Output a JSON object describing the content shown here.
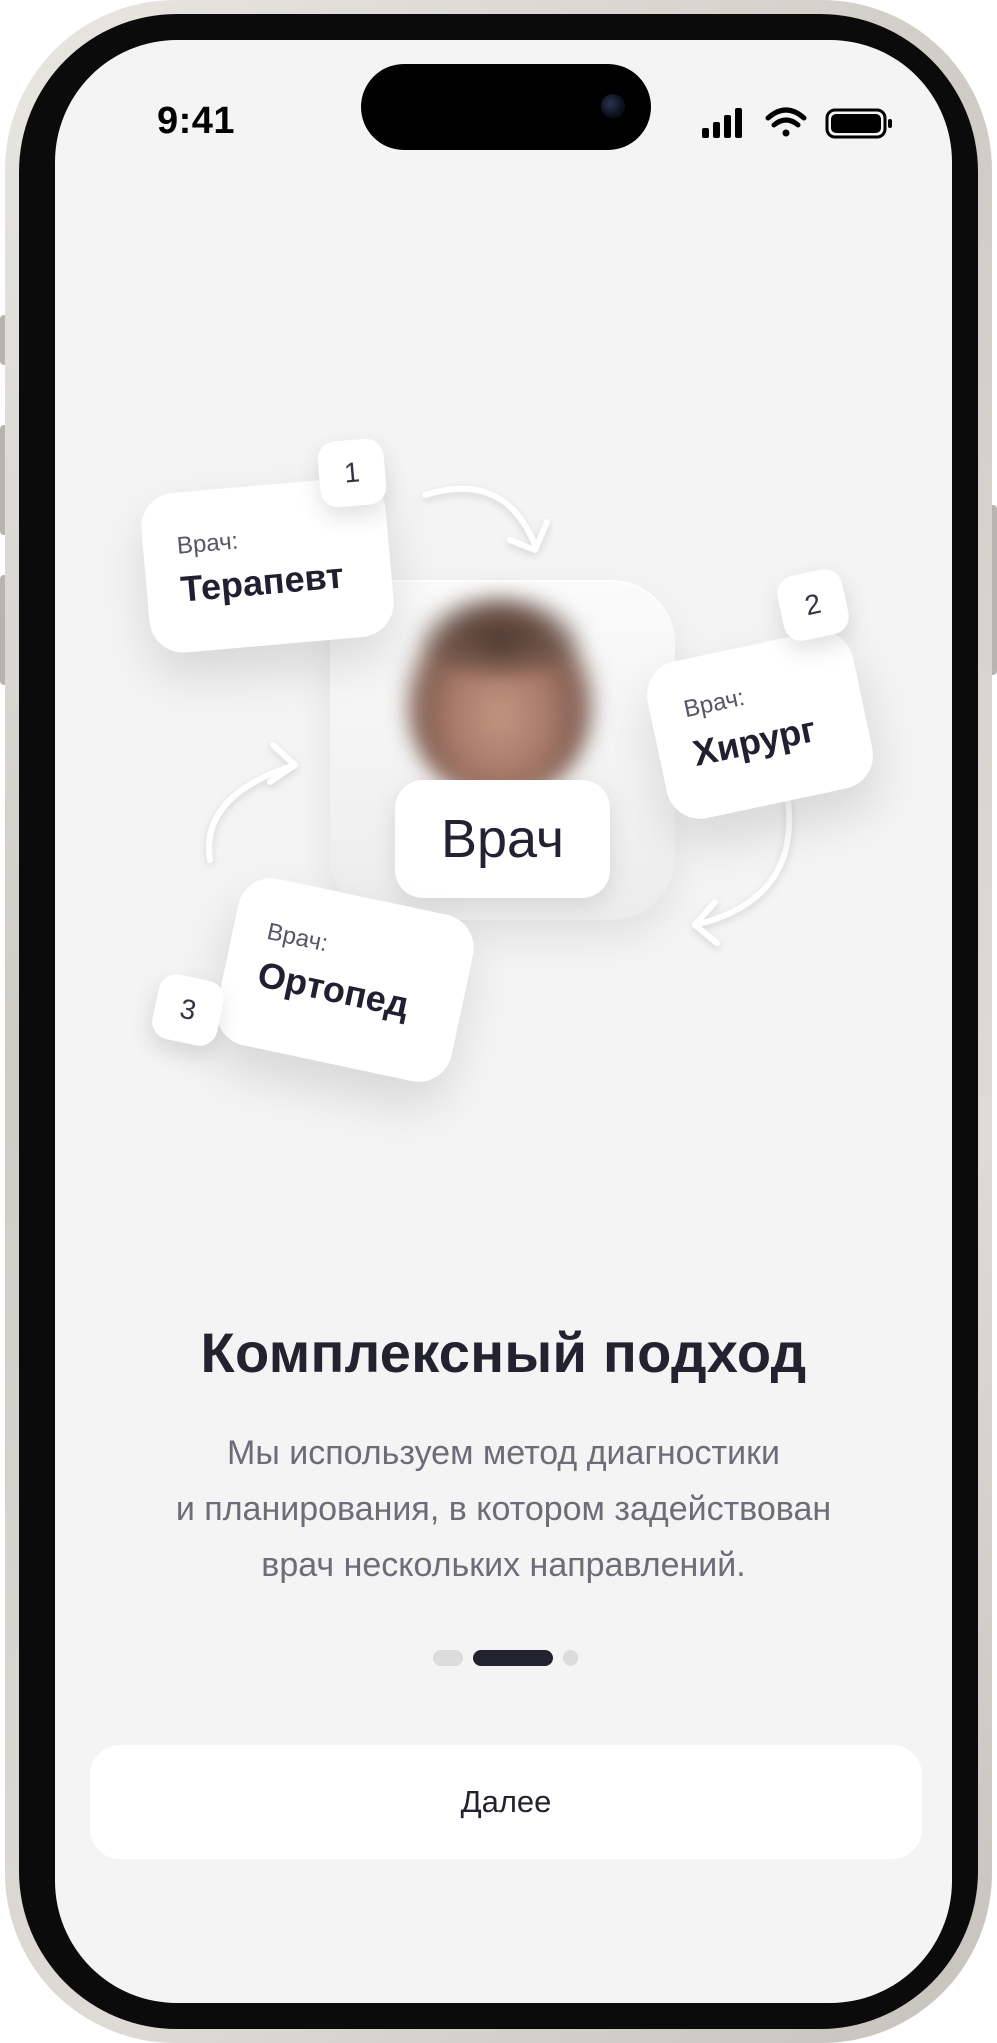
{
  "status_bar": {
    "time": "9:41",
    "icons": [
      "cellular-signal-icon",
      "wifi-icon",
      "battery-icon"
    ]
  },
  "illustration": {
    "center": {
      "label": "Врач",
      "avatar": "doctor-photo-blurred"
    },
    "cards": [
      {
        "step": "1",
        "caption": "Врач:",
        "name": "Терапевт"
      },
      {
        "step": "2",
        "caption": "Врач:",
        "name": "Хирург"
      },
      {
        "step": "3",
        "caption": "Врач:",
        "name": "Ортопед"
      }
    ]
  },
  "onboarding": {
    "title": "Комплексный подход",
    "description_lines": [
      "Мы используем метод диагностики",
      "и планирования, в котором задействован",
      "врач нескольких направлений."
    ],
    "pager": {
      "active_index": 1,
      "total": 3
    }
  },
  "actions": {
    "next_label": "Далее"
  },
  "colors": {
    "screen_bg": "#f4f4f4",
    "text_primary": "#23232f",
    "text_secondary": "#6d6d78",
    "pager_active": "#23232f",
    "pager_inactive": "#dcdcdc"
  }
}
